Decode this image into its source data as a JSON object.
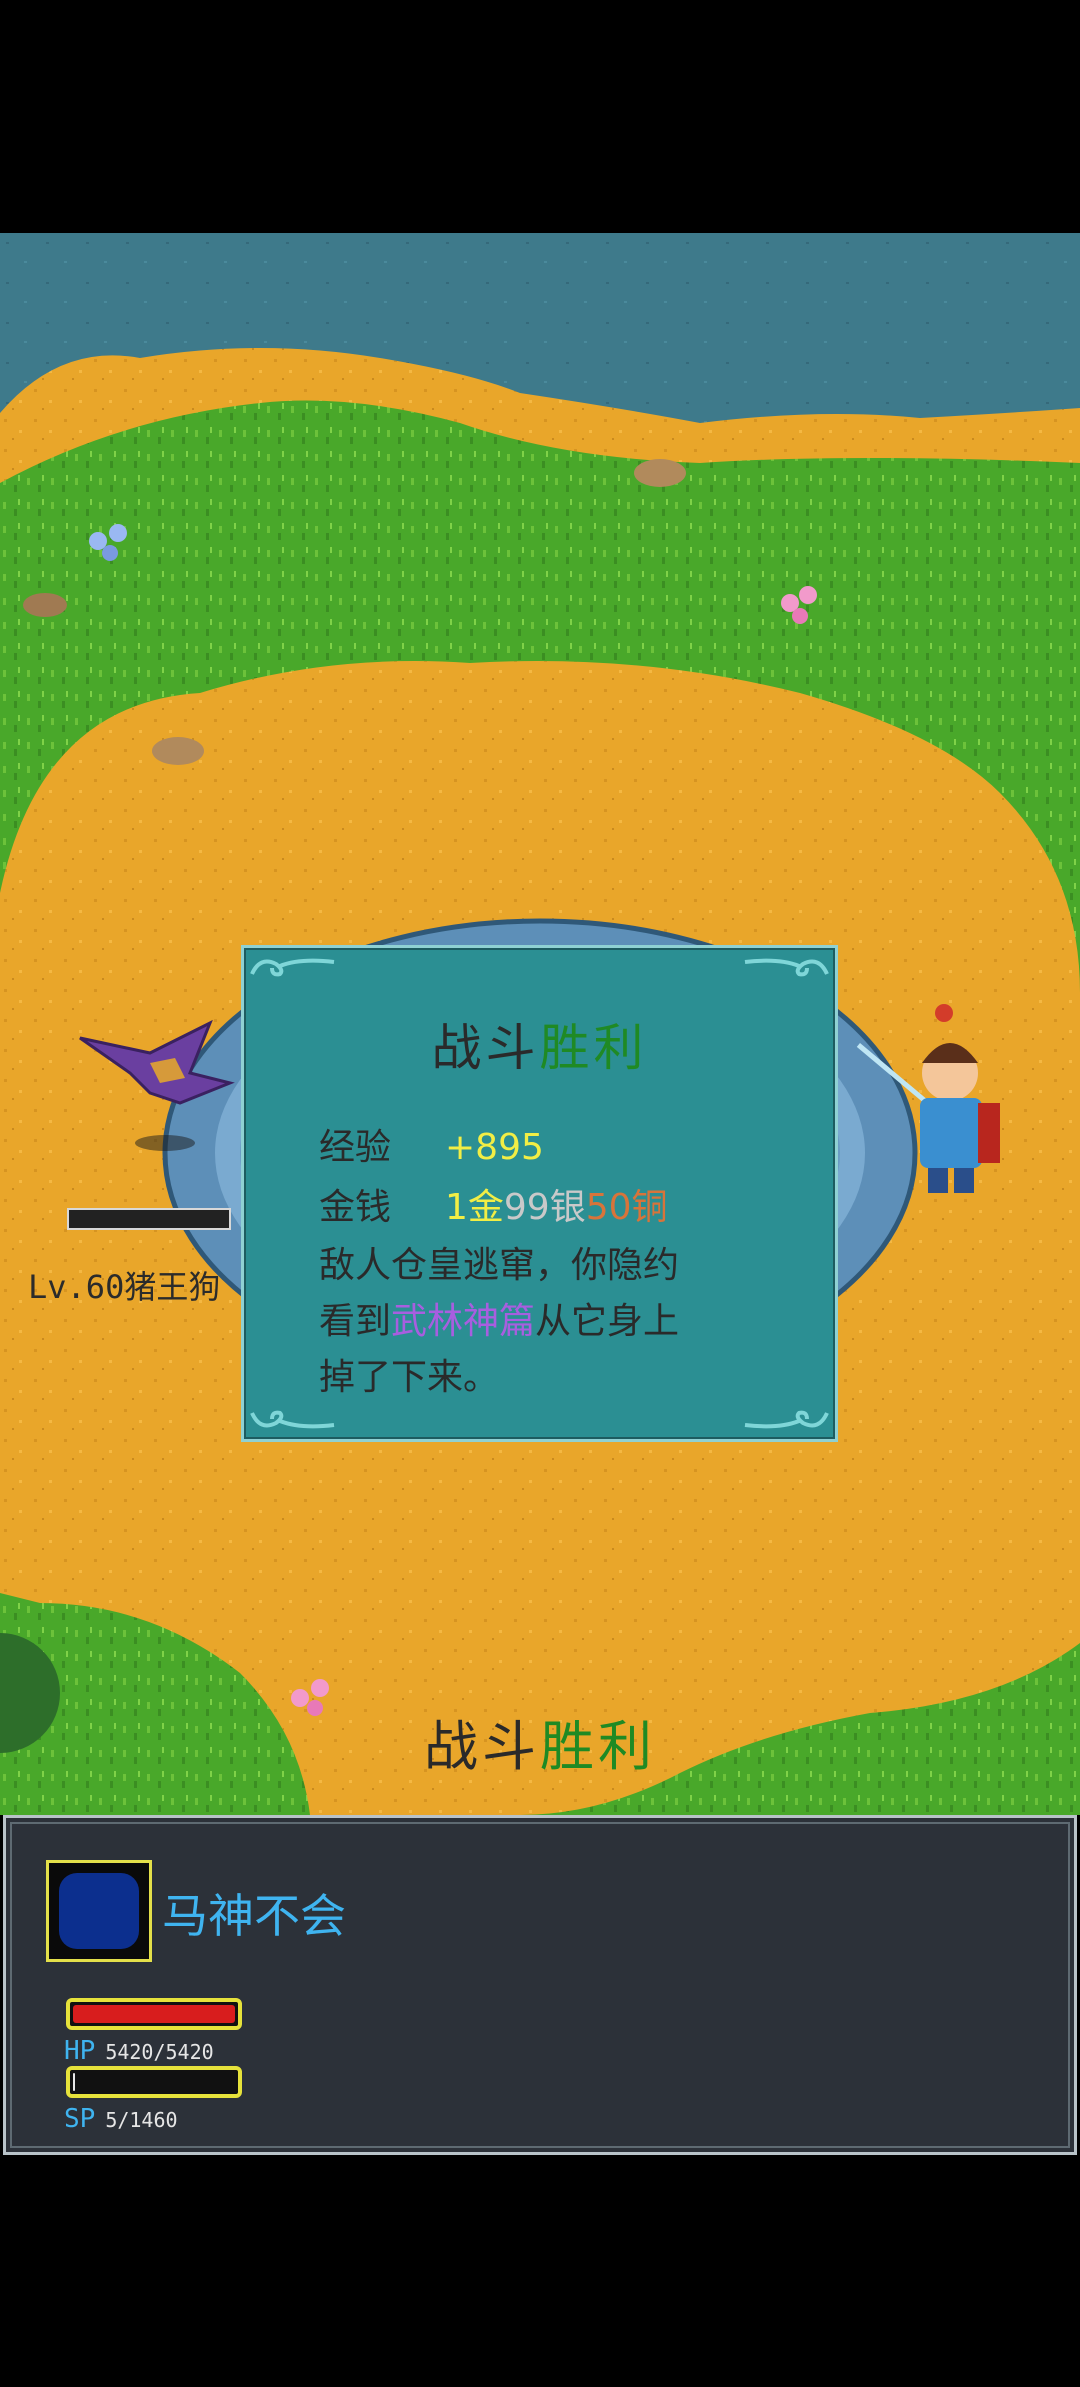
{
  "dialog": {
    "title_part1": "战斗",
    "title_part2": "胜利",
    "exp_label": "经验",
    "exp_value": "+895",
    "money_label": "金钱",
    "money_gold": "1金",
    "money_silver": "99银",
    "money_copper": "50铜",
    "message_line1": "敌人仓皇逃窜，你隐约",
    "message_line2_pre": "看到",
    "message_item": "武林神篇",
    "message_line2_post": "从它身上",
    "message_line3": "掉了下来。"
  },
  "banner": {
    "part1": "战斗",
    "part2": "胜利"
  },
  "enemy": {
    "label": "Lv.60猪王狗"
  },
  "player": {
    "name": "马神不会",
    "hp_label": "HP",
    "hp_value": "5420/5420",
    "hp_ratio": 1.0,
    "sp_label": "SP",
    "sp_value": "5/1460",
    "sp_ratio": 0.003
  },
  "colors": {
    "hp_fill": "#d81d1d",
    "sp_fill": "#e8e8e8",
    "accent_cyan": "#3fb4f0",
    "victory_green": "#1f8a24"
  },
  "icons": {
    "dialog_corner": "cloud-swirl-ornament",
    "avatar": "blue-portrait-frame"
  }
}
